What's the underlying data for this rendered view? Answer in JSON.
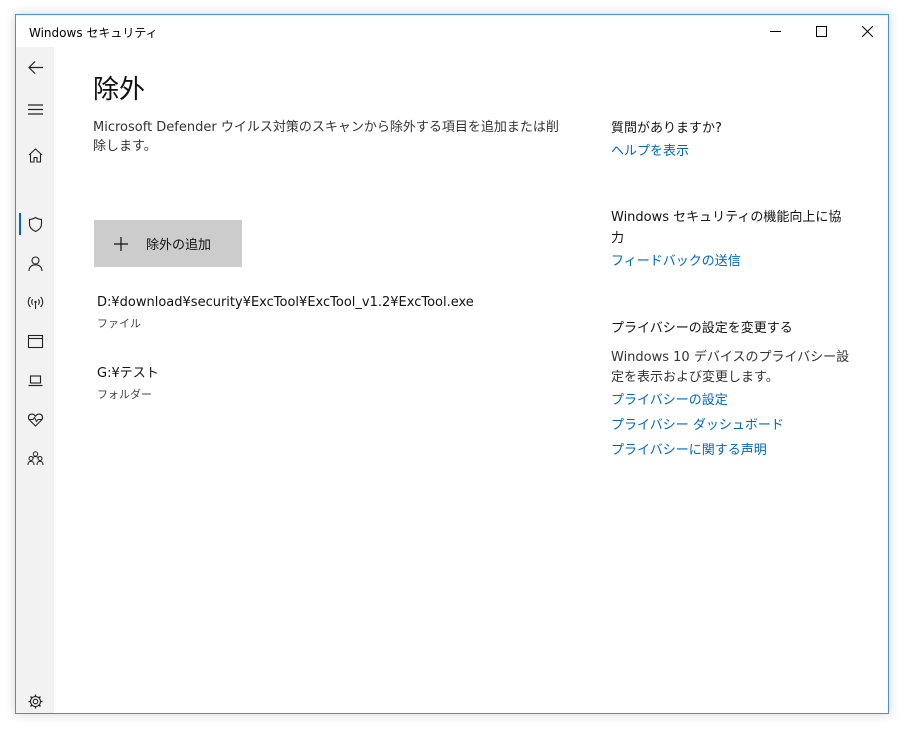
{
  "window": {
    "title": "Windows セキュリティ"
  },
  "sidebar": {
    "items": [
      {
        "icon": "back-arrow-icon"
      },
      {
        "icon": "hamburger-menu-icon"
      },
      {
        "icon": "home-icon"
      },
      {
        "icon": "shield-icon",
        "selected": true
      },
      {
        "icon": "person-icon"
      },
      {
        "icon": "wireless-icon"
      },
      {
        "icon": "app-browser-icon"
      },
      {
        "icon": "laptop-icon"
      },
      {
        "icon": "heart-pulse-icon"
      },
      {
        "icon": "family-icon"
      },
      {
        "icon": "settings-gear-icon"
      }
    ]
  },
  "main": {
    "title": "除外",
    "description": "Microsoft Defender ウイルス対策のスキャンから除外する項目を追加または削除します。",
    "add_button_label": "除外の追加",
    "exclusions": [
      {
        "path": "D:¥download¥security¥ExcTool¥ExcTool_v1.2¥ExcTool.exe",
        "type": "ファイル"
      },
      {
        "path": "G:¥テスト",
        "type": "フォルダー"
      }
    ]
  },
  "right_panel": {
    "question_heading": "質問がありますか?",
    "help_link": "ヘルプを表示",
    "improve_heading": "Windows セキュリティの機能向上に協力",
    "feedback_link": "フィードバックの送信",
    "privacy_heading": "プライバシーの設定を変更する",
    "privacy_text": "Windows 10 デバイスのプライバシー設定を表示および変更します。",
    "privacy_links": [
      "プライバシーの設定",
      "プライバシー ダッシュボード",
      "プライバシーに関する声明"
    ]
  },
  "colors": {
    "accent": "#0067c0",
    "sidebar_bg": "#f2f2f2",
    "button_bg": "#cccccc",
    "border": "#4a8fd6"
  }
}
